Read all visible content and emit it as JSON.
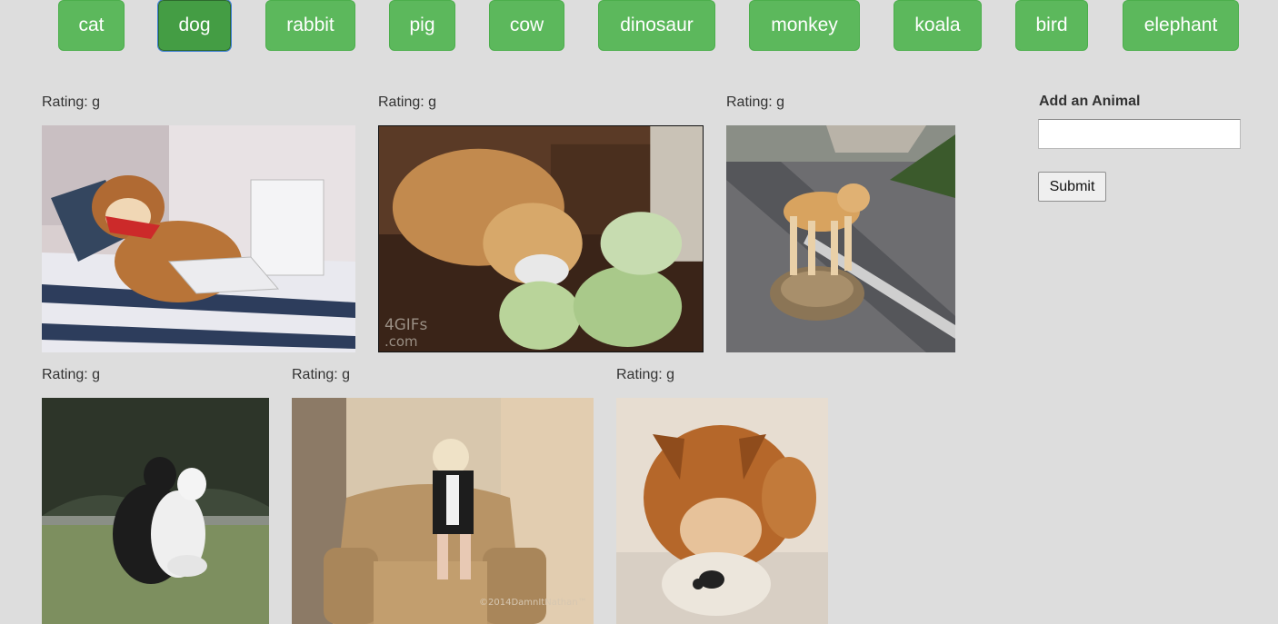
{
  "nav": {
    "buttons": [
      {
        "label": "cat"
      },
      {
        "label": "dog",
        "active": true
      },
      {
        "label": "rabbit"
      },
      {
        "label": "pig"
      },
      {
        "label": "cow"
      },
      {
        "label": "dinosaur"
      },
      {
        "label": "monkey"
      },
      {
        "label": "koala"
      },
      {
        "label": "bird"
      },
      {
        "label": "elephant"
      }
    ]
  },
  "results": [
    {
      "rating": "Rating: g"
    },
    {
      "rating": "Rating: g",
      "watermark_line1": "4GIFs",
      "watermark_line2": ".com"
    },
    {
      "rating": "Rating: g"
    },
    {
      "rating": "Rating: g"
    },
    {
      "rating": "Rating: g",
      "watermark": "©2014DamnItNathan™"
    },
    {
      "rating": "Rating: g"
    }
  ],
  "sidebar": {
    "title": "Add an Animal",
    "input_value": "",
    "submit_label": "Submit"
  },
  "colors": {
    "button_green": "#5cb85c",
    "button_active": "#449d44",
    "background": "#dddddd"
  }
}
